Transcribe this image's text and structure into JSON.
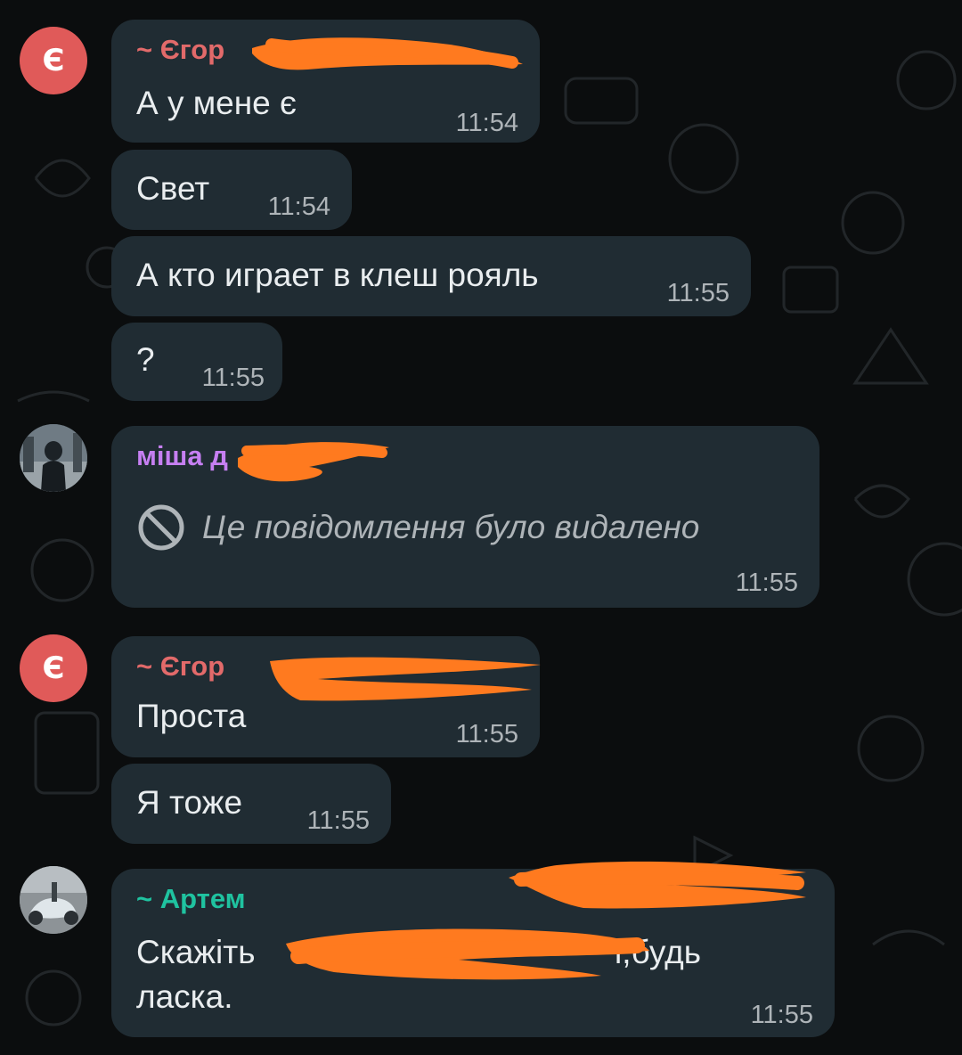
{
  "messages": [
    {
      "sender": "~ Єгор",
      "text": "А у мене є",
      "time": "11:54"
    },
    {
      "text": "Свет",
      "time": "11:54"
    },
    {
      "text": "А кто играет в клеш рояль",
      "time": "11:55"
    },
    {
      "text": "?",
      "time": "11:55"
    },
    {
      "sender": "міша д",
      "deleted_text": "Це повідомлення було видалено",
      "time": "11:55"
    },
    {
      "sender": "~ Єгор",
      "text": "Проста",
      "time": "11:55"
    },
    {
      "text": "Я тоже",
      "time": "11:55"
    },
    {
      "sender": "~ Артем",
      "text_line1_start": "Скажіть",
      "text_line1_end": "і,будь",
      "text_line2": "ласка.",
      "time": "11:55"
    }
  ],
  "avatars": {
    "egor_letter": "Є"
  },
  "colors": {
    "background": "#0b0d0e",
    "bubble": "#202c33",
    "egor_name": "#e26a6a",
    "misha_name": "#c67ff2",
    "artem_name": "#1fc3a0",
    "redaction": "#ff7a1f"
  },
  "icons": {
    "deleted": "prohibited-circle-icon"
  }
}
